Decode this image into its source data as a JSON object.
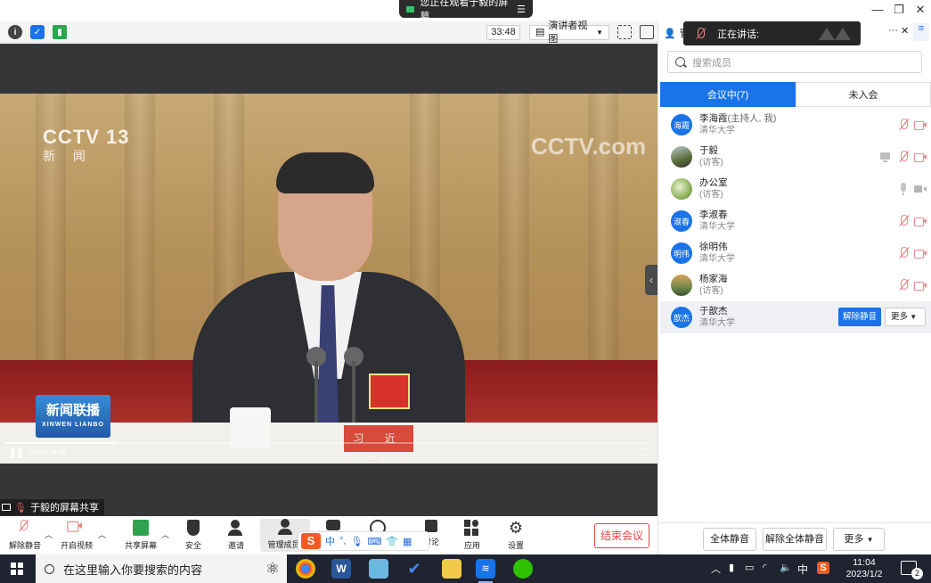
{
  "titlebar": {
    "viewing_banner": "您正在观看于毅的屏幕"
  },
  "meeting_bar": {
    "timer": "33:48",
    "view_mode": "演讲者视图"
  },
  "speaking_tip": {
    "label": "正在讲话:"
  },
  "video": {
    "channel_logo": "CCTV 13",
    "channel_sub": "新 闻",
    "watermark": "CCTV.com",
    "program_logo": "新闻联播",
    "program_logo_en": "XINWEN LIANBO",
    "nameplate": "习 近 平",
    "time": "02:34 / 14:59",
    "progress": 0.17
  },
  "share_label": "于毅的屏幕共享",
  "controls": {
    "unmute": "解除静音",
    "start_video": "开启视频",
    "share_screen": "共享屏幕",
    "security": "安全",
    "invite": "邀请",
    "manage_members": "管理成员(",
    "discuss": "讨论",
    "apps": "应用",
    "settings": "设置",
    "end_meeting": "结束会议"
  },
  "ime": {
    "logo": "S",
    "lang": "中"
  },
  "panel": {
    "title_fragment": "管",
    "search_placeholder": "搜索成员",
    "tabs": [
      "会议中(7)",
      "未入会"
    ],
    "members": [
      {
        "avatar": "海霞",
        "name": "李海霞",
        "role": "(主持人, 我)",
        "sub": "清华大学",
        "avatar_type": "blue",
        "mic": "muted",
        "cam": "off",
        "screen": false
      },
      {
        "avatar": "",
        "name": "于毅",
        "role": "",
        "sub": "(访客)",
        "avatar_type": "photo1",
        "mic": "muted",
        "cam": "off",
        "screen": true
      },
      {
        "avatar": "",
        "name": "办公室",
        "role": "",
        "sub": "(访客)",
        "avatar_type": "photo2",
        "mic": "on",
        "cam": "on",
        "screen": false
      },
      {
        "avatar": "淑春",
        "name": "李淑春",
        "role": "",
        "sub": "清华大学",
        "avatar_type": "blue",
        "mic": "muted",
        "cam": "off",
        "screen": false
      },
      {
        "avatar": "明伟",
        "name": "徐明伟",
        "role": "",
        "sub": "清华大学",
        "avatar_type": "blue",
        "mic": "muted",
        "cam": "off",
        "screen": false
      },
      {
        "avatar": "",
        "name": "杨家海",
        "role": "",
        "sub": "(访客)",
        "avatar_type": "photo3",
        "mic": "muted",
        "cam": "off",
        "screen": false
      },
      {
        "avatar": "歆杰",
        "name": "于歆杰",
        "role": "",
        "sub": "清华大学",
        "avatar_type": "blue",
        "mic": "",
        "cam": "",
        "screen": false
      }
    ],
    "row_unmute": "解除静音",
    "row_more": "更多",
    "footer": {
      "mute_all": "全体静音",
      "unmute_all": "解除全体静音",
      "more": "更多"
    }
  },
  "taskbar": {
    "search_placeholder": "在这里输入你要搜索的内容",
    "ime_lang": "中",
    "time": "11:04",
    "date": "2023/1/2",
    "notifications": "2"
  },
  "colors": {
    "accent": "#1a73e8",
    "end_red": "#e64545",
    "taskbar": "#1f2430"
  }
}
